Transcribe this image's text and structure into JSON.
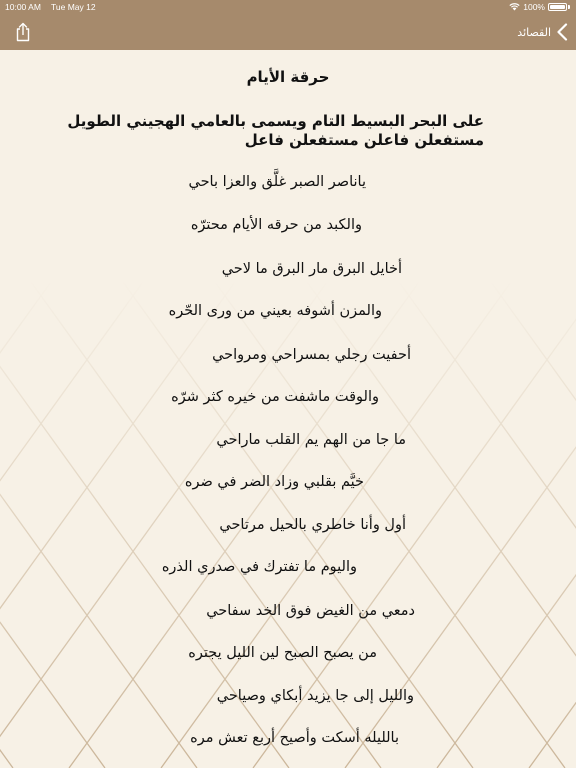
{
  "status_bar": {
    "time": "10:00 AM",
    "date": "Tue May 12",
    "battery": "100%",
    "wifi_icon": "wifi-icon",
    "battery_icon": "battery-icon"
  },
  "nav": {
    "back_label": "القصائد",
    "back_icon": "chevron-left-icon",
    "share_icon": "share-icon"
  },
  "colors": {
    "nav_bar": "#a68a6c",
    "background": "#f7f1e6",
    "text": "#111111"
  },
  "poem": {
    "title": "حرقة الأيام",
    "meter_line1": "على البحر البسيط التام ويسمى بالعامي الهجيني الطويل",
    "meter_line2": "مستفعلن فاعلن مستفعلن فاعل",
    "verses": [
      "ياناصر الصبر غلَّق والعزا باحي",
      "والكبد من حرقه الأيام محترّه",
      "أخايل البرق مار البرق ما لاحي",
      "والمزن أشوفه بعيني من ورى الحّره",
      "أحفيت رجلي بمسراحي ومرواحي",
      "والوقت ماشفت من خيره كثر شرّه",
      "ما جا من الهم يم القلب ماراحي",
      "خيَّم بقلبي وزاد الضر في ضره",
      "أول وأنا خاطري بالحيل مرتاحي",
      "واليوم ما تفترك في صدري الذره",
      "دمعي من الغيض فوق الخد سفاحي",
      "من يصبح الصبح لين الليل يجتره",
      "والليل إلى جا يزيد أبكاي وصياحي",
      "بالليله أسكت وأصيح أربع تعش مره"
    ]
  }
}
